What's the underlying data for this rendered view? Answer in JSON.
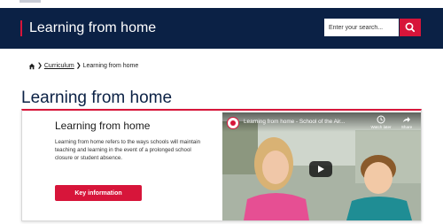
{
  "header": {
    "site_title": "Learning from home",
    "search_placeholder": "Enter your search...",
    "search_icon": "search-icon"
  },
  "breadcrumb": {
    "home_icon": "home-icon",
    "items": [
      "Curriculum",
      "Learning from home"
    ]
  },
  "page": {
    "title": "Learning from home"
  },
  "card": {
    "title": "Learning from home",
    "body": "Learning from home refers to the ways schools will maintain teaching and learning in the event of a prolonged school closure or student absence.",
    "button_label": "Key information"
  },
  "video": {
    "title": "Learning from home - School of the Air...",
    "watch_later_label": "Watch later",
    "share_label": "Share",
    "play_icon": "play-icon"
  },
  "colors": {
    "header_bg": "#0b2145",
    "accent_red": "#d7153a",
    "title_navy": "#0b2145"
  }
}
